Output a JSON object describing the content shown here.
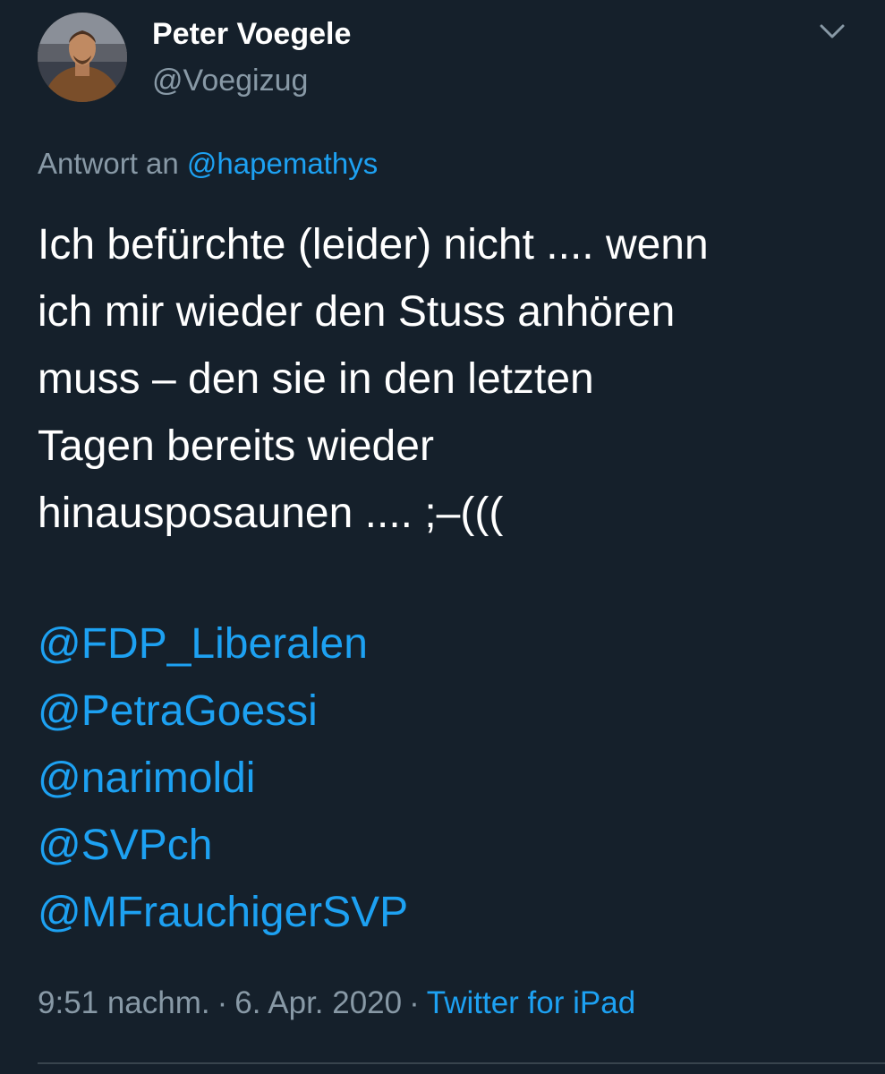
{
  "author": {
    "display_name": "Peter Voegele",
    "handle": "@Voegizug"
  },
  "icons": {
    "avatar": "profile-photo",
    "menu": "chevron-down-icon"
  },
  "reply": {
    "prefix": "Antwort an",
    "to": "@hapemathys"
  },
  "body": {
    "lines": [
      "Ich befürchte (leider) nicht .... wenn",
      "ich mir wieder den Stuss anhören",
      "muss – den sie in den letzten",
      "Tagen bereits wieder",
      "hinausposaunen .... ;–((("
    ]
  },
  "mentions": [
    "@FDP_Liberalen",
    "@PetraGoessi",
    "@narimoldi",
    "@SVPch",
    "@MFrauchigerSVP"
  ],
  "meta": {
    "time": "9:51 nachm.",
    "separator": "·",
    "date": "6. Apr. 2020",
    "source": "Twitter for iPad"
  },
  "colors": {
    "background": "#15202b",
    "primary_text": "#ffffff",
    "secondary_text": "#8899a6",
    "link": "#1da1f2",
    "divider": "#38444d"
  }
}
